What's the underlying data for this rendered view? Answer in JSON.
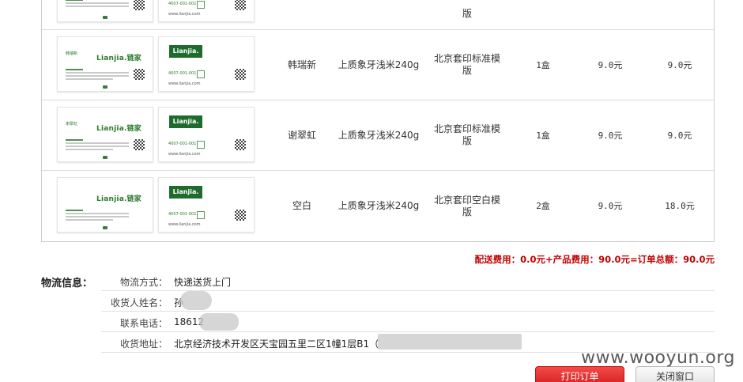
{
  "order": {
    "brand_front": "Lianjia.链家",
    "brand_back": "Lianjia.",
    "back_phone": "4007-001-001",
    "back_url": "www.lianjia.com",
    "partial_row": {
      "template": "版"
    },
    "rows": [
      {
        "name": "韩瑞新",
        "paper": "上质象牙浅米240g",
        "template": "北京套印标准模版",
        "qty": "1盒",
        "unit_price": "9.0元",
        "subtotal": "9.0元"
      },
      {
        "name": "谢翠虹",
        "paper": "上质象牙浅米240g",
        "template": "北京套印标准模版",
        "qty": "1盒",
        "unit_price": "9.0元",
        "subtotal": "9.0元"
      },
      {
        "name": "空白",
        "paper": "上质象牙浅米240g",
        "template": "北京套印空白模版",
        "qty": "2盒",
        "unit_price": "9.0元",
        "subtotal": "18.0元"
      }
    ]
  },
  "totals": {
    "text": "配送费用：0.0元+产品费用：90.0元=订单总额：90.0元",
    "color": "#c00000"
  },
  "logistics": {
    "title": "物流信息：",
    "fields": [
      {
        "label": "物流方式：",
        "value": "快递送货上门"
      },
      {
        "label": "收货人姓名：",
        "value": "孙"
      },
      {
        "label": "联系电话：",
        "value": "18612"
      },
      {
        "label": "收货地址：",
        "value": "北京经济技术开发区天宝园五里二区1幢1层B1（"
      }
    ]
  },
  "buttons": {
    "print": "打印订单",
    "close": "关闭窗口",
    "print_color": "#e02b2b"
  },
  "watermark": "www.wooyun.org"
}
